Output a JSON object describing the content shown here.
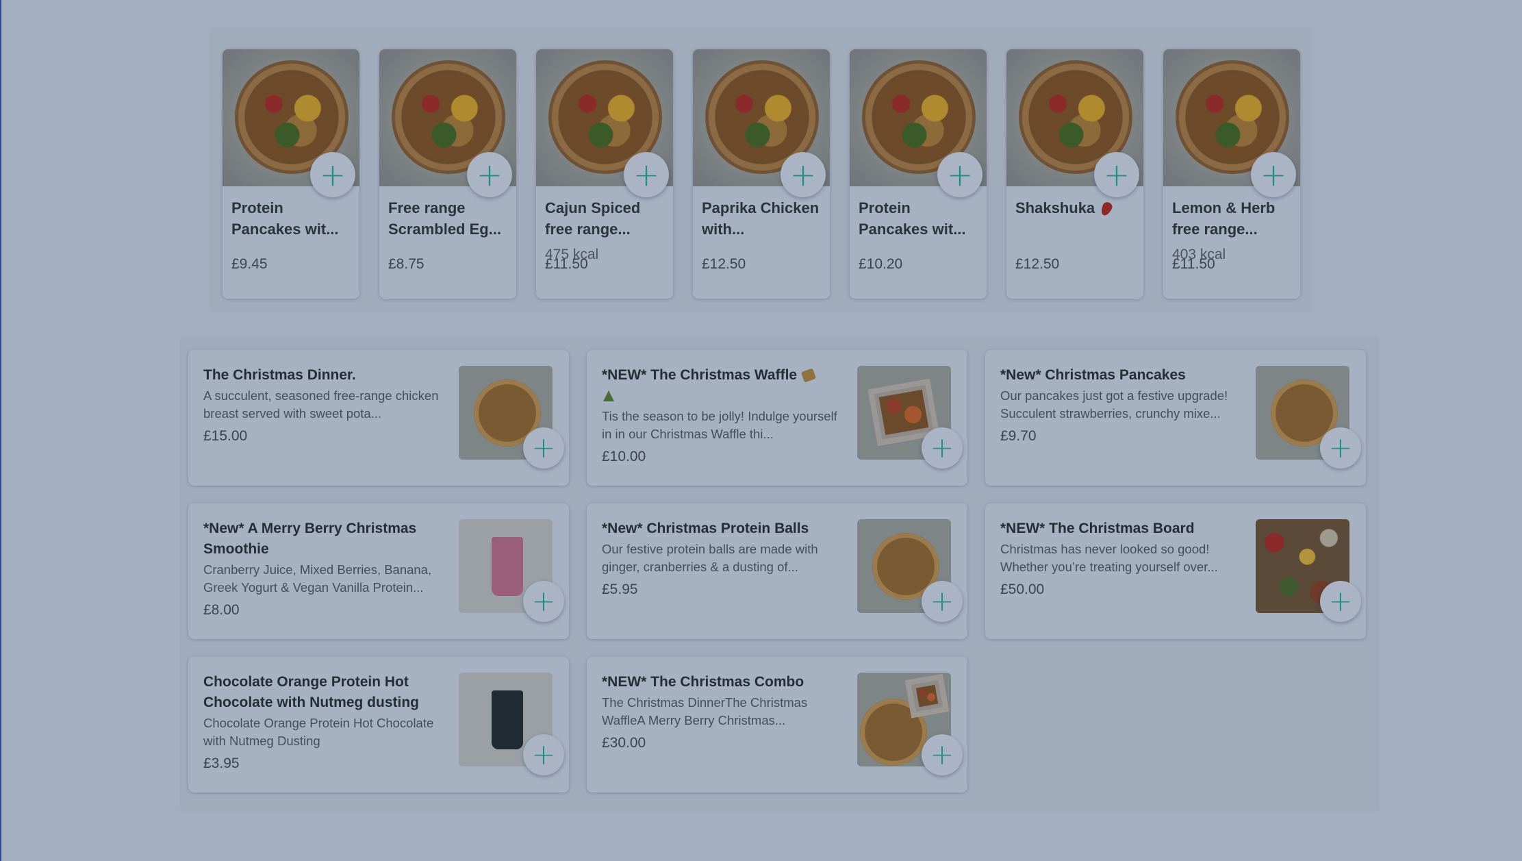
{
  "carousel": {
    "items": [
      {
        "name": "Protein Pancakes wit...",
        "kcal": "",
        "price": "£9.45"
      },
      {
        "name": "Free range Scrambled Eg...",
        "kcal": "",
        "price": "£8.75"
      },
      {
        "name": "Cajun Spiced free range...",
        "kcal": "475 kcal",
        "price": "£11.50"
      },
      {
        "name": "Paprika Chicken with...",
        "kcal": "",
        "price": "£12.50"
      },
      {
        "name": "Protein Pancakes wit...",
        "kcal": "",
        "price": "£10.20"
      },
      {
        "name": "Shakshuka",
        "kcal": "",
        "price": "£12.50"
      },
      {
        "name": "Lemon & Herb free range...",
        "kcal": "403 kcal",
        "price": "£11.50"
      }
    ],
    "add_label": "+"
  },
  "grid": {
    "items": [
      {
        "title": "The Christmas Dinner.",
        "desc": "A succulent, seasoned free-range chicken breast served with sweet pota...",
        "price": "£15.00"
      },
      {
        "title": "*NEW* The Christmas Waffle",
        "desc": "Tis the season to be jolly! Indulge yourself in in our Christmas Waffle thi...",
        "price": "£10.00"
      },
      {
        "title": "*New* Christmas Pancakes",
        "desc": "Our pancakes just got a festive upgrade! Succulent strawberries, crunchy mixe...",
        "price": "£9.70"
      },
      {
        "title": "*New* A Merry Berry Christmas Smoothie",
        "desc": "Cranberry Juice, Mixed Berries, Banana, Greek Yogurt & Vegan Vanilla Protein...",
        "price": "£8.00"
      },
      {
        "title": "*New* Christmas Protein Balls",
        "desc": "Our festive protein balls are made with ginger, cranberries & a dusting of...",
        "price": "£5.95"
      },
      {
        "title": "*NEW* The Christmas Board",
        "desc": "Christmas has never looked so good! Whether you’re treating yourself over...",
        "price": "£50.00"
      },
      {
        "title": "Chocolate Orange Protein Hot Chocolate with Nutmeg dusting",
        "desc": "Chocolate Orange Protein Hot Chocolate with Nutmeg Dusting",
        "price": "£3.95"
      },
      {
        "title": "*NEW* The Christmas Combo",
        "desc": "The Christmas DinnerThe Christmas WaffleA Merry Berry Christmas...",
        "price": "£30.00"
      }
    ]
  },
  "colors": {
    "overlay": "#a3afc0",
    "accent": "#1f8f83"
  }
}
